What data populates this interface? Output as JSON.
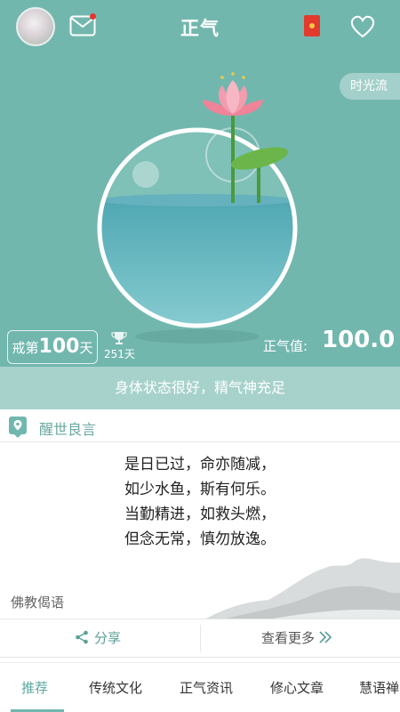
{
  "header": {
    "title": "正气"
  },
  "scene": {
    "timeflow_label": "时光流",
    "days_prefix": "戒第",
    "days_count": "100",
    "days_suffix": "天",
    "record_days": "251天",
    "zhengqi_label": "正气值:",
    "zhengqi_value": "100.0"
  },
  "status_text": "身体状态很好，精气神充足",
  "card": {
    "title": "醒世良言",
    "poem": [
      "是日已过，命亦随减，",
      "如少水鱼，斯有何乐。",
      "当勤精进，如救头燃，",
      "但念无常，慎勿放逸。"
    ],
    "source": "佛教偈语"
  },
  "actions": {
    "share_label": "分享",
    "more_label": "查看更多"
  },
  "tabs": [
    {
      "label": "推荐",
      "active": true
    },
    {
      "label": "传统文化",
      "active": false
    },
    {
      "label": "正气资讯",
      "active": false
    },
    {
      "label": "修心文章",
      "active": false
    },
    {
      "label": "慧语禅",
      "active": false
    }
  ],
  "colors": {
    "teal": "#72b7ae",
    "status_bg": "#a7d2cb",
    "accent": "#5aa79d",
    "lotus": "#f08aa0",
    "leaf": "#6cb54a"
  },
  "icons": [
    "avatar",
    "mail-icon",
    "red-packet-icon",
    "heart-icon",
    "lotus-icon",
    "trophy-icon",
    "location-pin-icon",
    "share-icon",
    "chevron-double-right-icon"
  ]
}
